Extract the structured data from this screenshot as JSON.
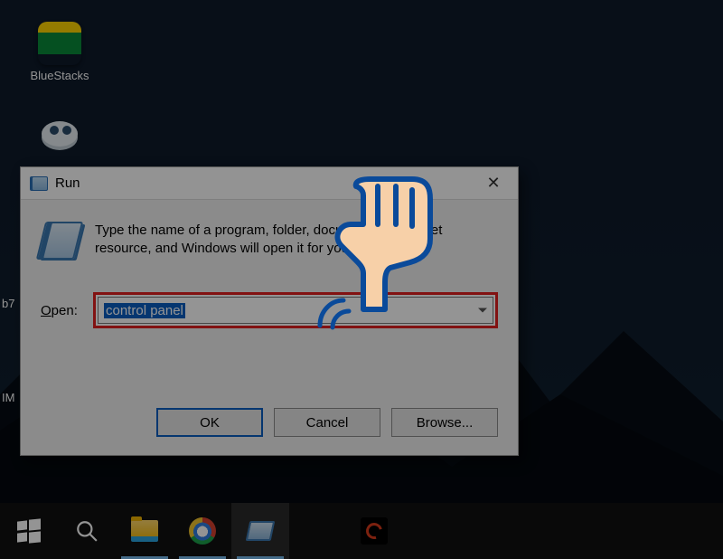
{
  "desktop_icons": {
    "bluestacks": {
      "label": "BlueStacks"
    }
  },
  "edge_labels": {
    "b7": "b7",
    "im": "IM"
  },
  "run_dialog": {
    "title": "Run",
    "description": "Type the name of a program, folder, document, or Internet resource, and Windows will open it for you.",
    "open_label_prefix": "O",
    "open_label_rest": "pen:",
    "input_value": "control panel",
    "buttons": {
      "ok": "OK",
      "cancel": "Cancel",
      "browse": "Browse..."
    },
    "close_glyph": "✕"
  },
  "taskbar": {
    "items": [
      "start",
      "search",
      "file-explorer",
      "chrome",
      "run",
      "garena"
    ]
  }
}
